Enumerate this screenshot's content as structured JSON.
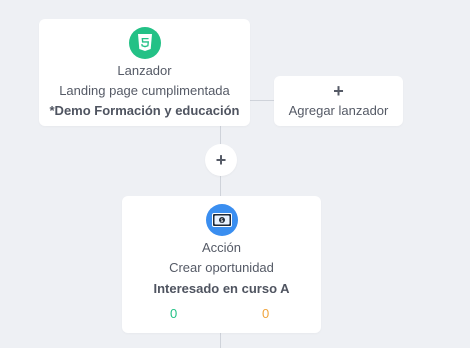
{
  "colors": {
    "background": "#eef0f4",
    "trigger_icon_bg": "#23c186",
    "action_icon_bg": "#3a8ef0",
    "success_count": "#23c186",
    "warning_count": "#f0a43c"
  },
  "trigger": {
    "icon": "html5-icon",
    "title": "Lanzador",
    "description": "Landing page cumplimentada",
    "name": "*Demo Formación y educación"
  },
  "add_trigger": {
    "icon": "plus-icon",
    "label": "Agregar lanzador"
  },
  "add_step": {
    "icon": "plus-icon"
  },
  "action": {
    "icon": "money-icon",
    "title": "Acción",
    "description": "Crear oportunidad",
    "name": "Interesado en curso A",
    "count_success": "0",
    "count_warning": "0"
  }
}
